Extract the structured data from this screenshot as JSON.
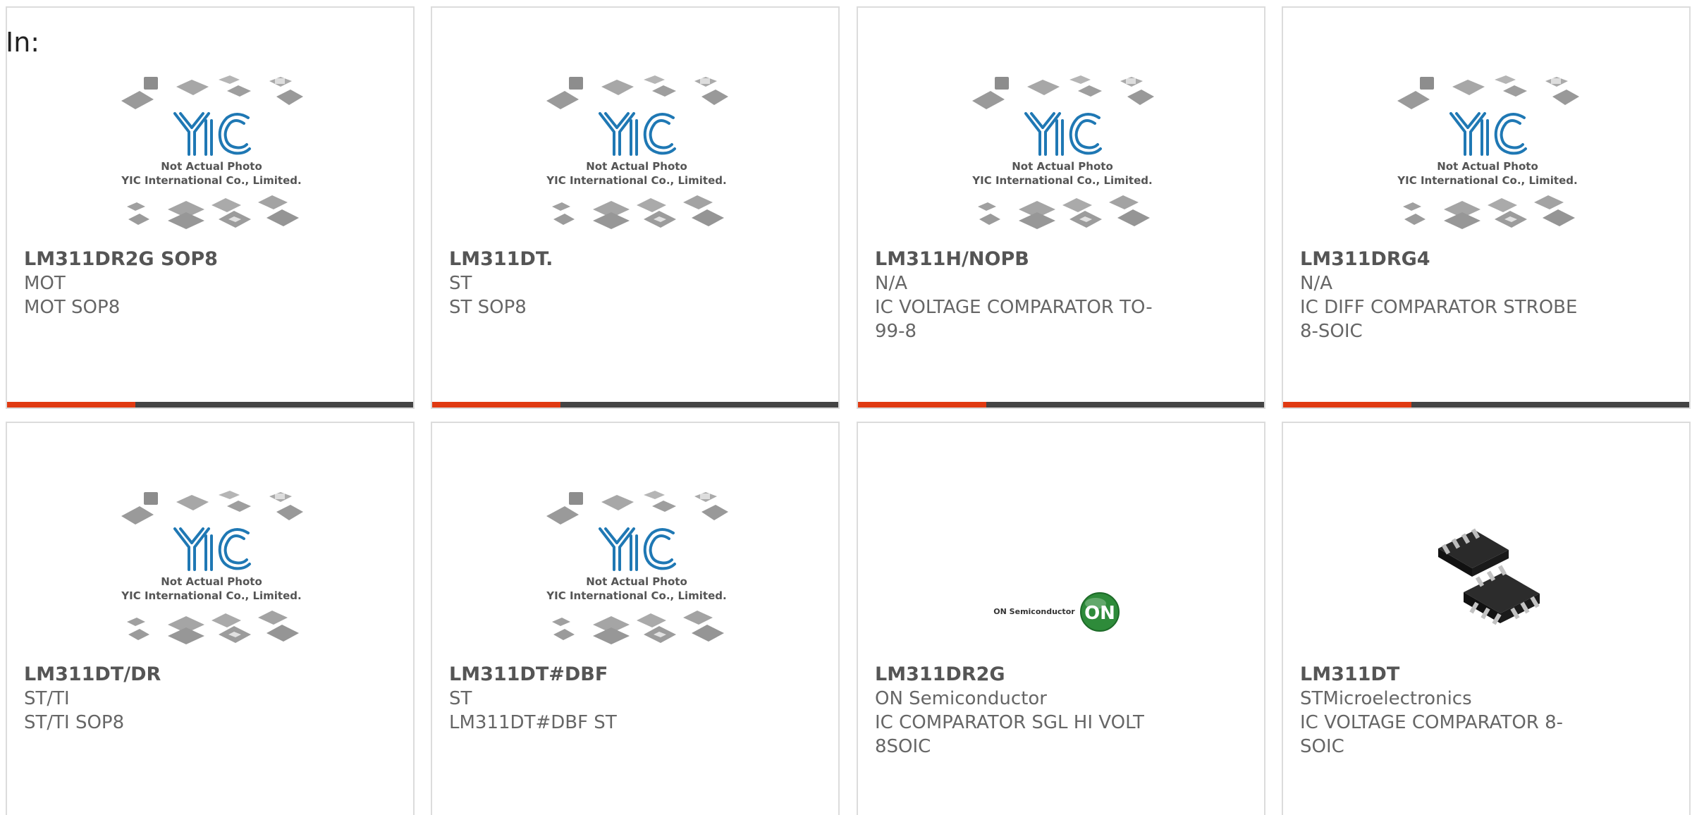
{
  "header": {
    "in_label": "In:"
  },
  "placeholder": {
    "line1": "Not Actual Photo",
    "line2": "YIC International Co., Limited.",
    "logo": "YIC"
  },
  "products": [
    {
      "part": "LM311DR2G SOP8",
      "maker": "MOT",
      "description": "MOT SOP8",
      "image": "yic-placeholder"
    },
    {
      "part": "LM311DT.",
      "maker": "ST",
      "description": "ST SOP8",
      "image": "yic-placeholder"
    },
    {
      "part": "LM311H/NOPB",
      "maker": "N/A",
      "description": "IC VOLTAGE COMPARATOR TO-99-8",
      "image": "yic-placeholder"
    },
    {
      "part": "LM311DRG4",
      "maker": "N/A",
      "description": "IC DIFF COMPARATOR STROBE 8-SOIC",
      "image": "yic-placeholder"
    },
    {
      "part": "LM311DT/DR",
      "maker": "ST/TI",
      "description": "ST/TI SOP8",
      "image": "yic-placeholder"
    },
    {
      "part": "LM311DT#DBF",
      "maker": "ST",
      "description": "LM311DT#DBF ST",
      "image": "yic-placeholder"
    },
    {
      "part": "LM311DR2G",
      "maker": "ON Semiconductor",
      "description": "IC COMPARATOR SGL HI VOLT 8SOIC",
      "image": "on-semiconductor-logo",
      "logo_text": "ON Semiconductor",
      "logo_mark": "ON"
    },
    {
      "part": "LM311DT",
      "maker": "STMicroelectronics",
      "description": "IC VOLTAGE COMPARATOR 8-SOIC",
      "image": "soic8-chip-photo"
    }
  ],
  "colors": {
    "accent": "#e03a12",
    "bar": "#444444",
    "logo_blue": "#1f78b4",
    "chip_grey": "#aaaaaa",
    "on_green": "#2e8b3a"
  }
}
